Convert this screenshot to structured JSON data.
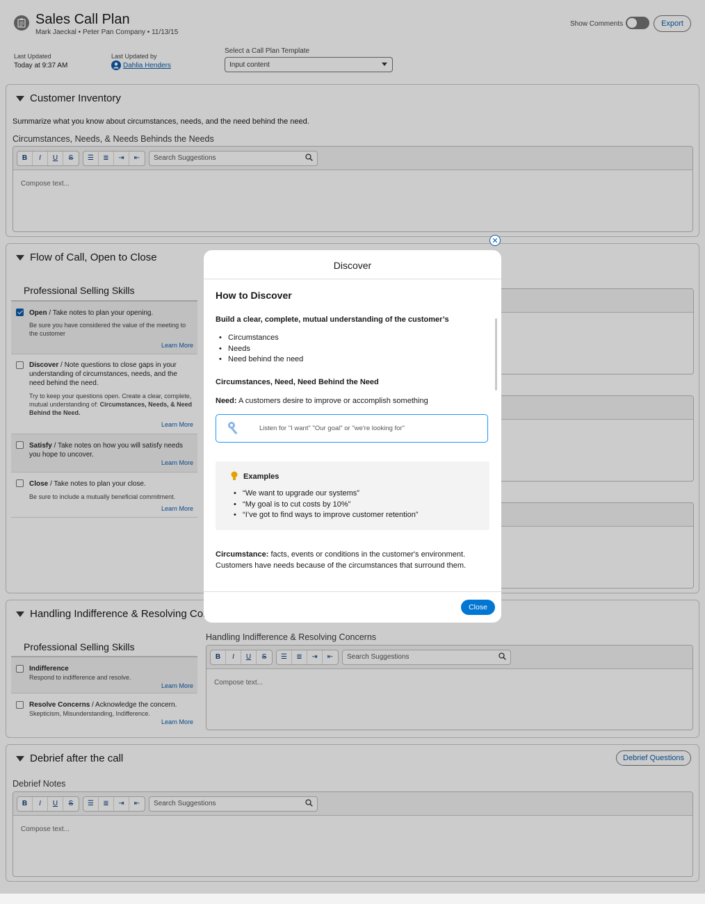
{
  "header": {
    "title": "Sales Call Plan",
    "subtitle": "Mark Jaeckal • Peter Pan Company • 11/13/15",
    "show_comments_label": "Show Comments",
    "export_label": "Export",
    "last_updated_label": "Last Updated",
    "last_updated_value": "Today at 9:37 AM",
    "last_updated_by_label": "Last Updated by",
    "last_updated_by_value": "Dahlia Henders",
    "template_label": "Select a Call Plan Template",
    "template_value": "Input content"
  },
  "toolbar": {
    "bold": "B",
    "italic": "I",
    "underline": "U",
    "strike": "S",
    "search_placeholder": "Search Suggestions",
    "compose_placeholder": "Compose text..."
  },
  "customer_inventory": {
    "title": "Customer Inventory",
    "description": "Summarize what you know about circumstances, needs, and the need behind the need.",
    "field_label": "Circumstances, Needs, & Needs Behinds the Needs"
  },
  "flow_of_call": {
    "title": "Flow of Call, Open to Close",
    "skills_title": "Professional Selling Skills",
    "skills": [
      {
        "name": "Open",
        "rest": " / Take notes to plan your opening.",
        "desc": "Be sure you have considered the value of the meeting to the customer",
        "learn": "Learn More",
        "checked": true
      },
      {
        "name": "Discover",
        "rest": " / Note questions to close gaps in your understanding of circumstances, needs, and the need behind the need.",
        "desc_pre": "Try to keep your questions open. Create a clear, complete, mutual understanding of: ",
        "desc_bold": "Circumstances, Needs, & Need Behind the Need.",
        "learn": "Learn More",
        "checked": false
      },
      {
        "name": "Satisfy",
        "rest": " / Take notes on how you will satisfy needs you hope to uncover.",
        "learn": "Learn More",
        "checked": false
      },
      {
        "name": "Close",
        "rest": " / Take notes to plan your close.",
        "desc": "Be sure to include a mutually beneficial commitment.",
        "learn": "Learn More",
        "checked": false
      }
    ]
  },
  "handling": {
    "title": "Handling Indifference & Resolving Con",
    "skills_title": "Professional Selling Skills",
    "field_label": "Handling Indifference & Resolving Concerns",
    "skills": [
      {
        "name": "Indifference",
        "desc": "Respond to indifference and resolve.",
        "learn": "Learn More"
      },
      {
        "name": "Resolve Concerns",
        "rest": " / Acknowledge the concern.",
        "desc": "Skepticism, Misunderstanding, Indifference.",
        "learn": "Learn More"
      }
    ]
  },
  "debrief": {
    "title": "Debrief after the call",
    "button": "Debrief Questions",
    "field_label": "Debrief Notes"
  },
  "modal": {
    "title": "Discover",
    "heading": "How to Discover",
    "intro": "Build a clear, complete, mutual understanding of the customer’s",
    "bullets": [
      "Circumstances",
      "Needs",
      "Need behind the need"
    ],
    "subheading": "Circumstances, Need, Need Behind the Need",
    "need_label": "Need:",
    "need_text": " A customers desire to improve or accomplish something",
    "listen_text": "Listen for \"I want\" \"Our goal\" or \"we're looking for\"",
    "examples_title": "Examples",
    "examples": [
      "“We want to upgrade our systems”",
      "“My goal is to cut costs by 10%”",
      "“I’ve got to find ways to improve customer retention”"
    ],
    "circumstance_label": "Circumstance:",
    "circumstance_text": " facts, events or conditions in the customer's environment. Customers have needs because of the circumstances that surround them.",
    "close_label": "Close"
  },
  "colors": {
    "brand": "#0b5cab",
    "close_button": "#0176d3"
  }
}
